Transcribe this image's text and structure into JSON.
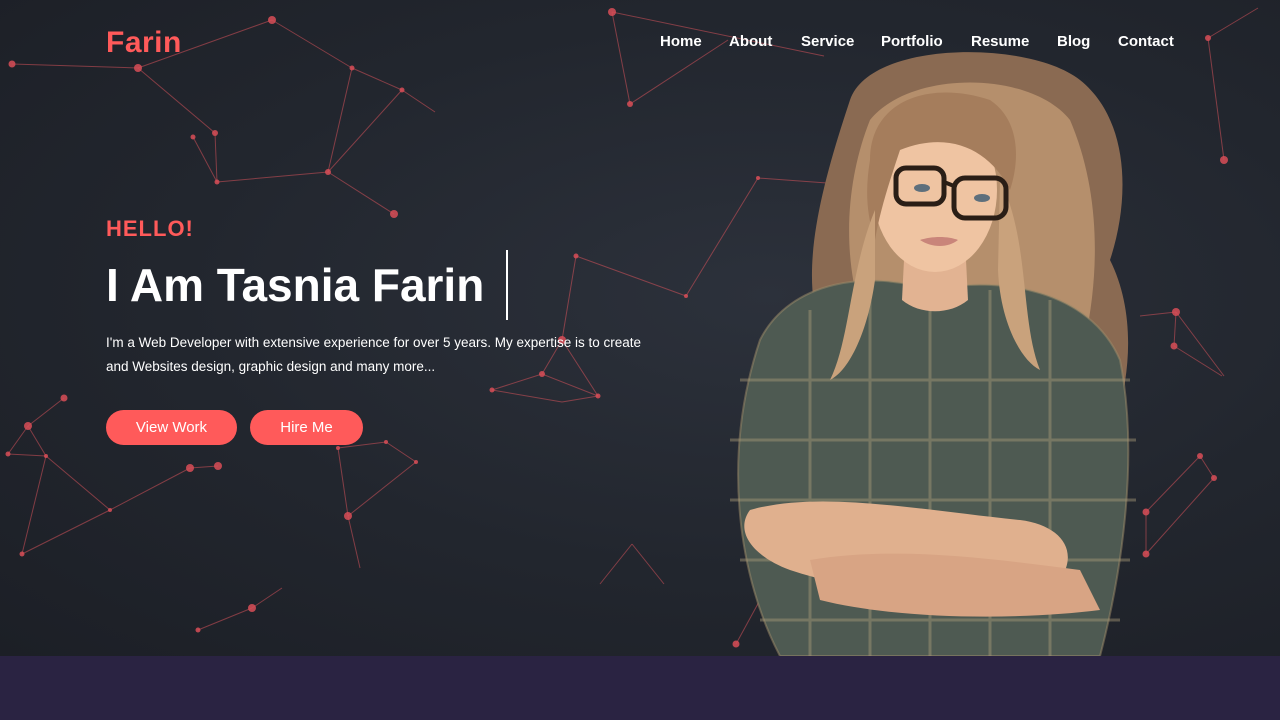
{
  "header": {
    "logo": "Farin",
    "nav": [
      "Home",
      "About",
      "Service",
      "Portfolio",
      "Resume",
      "Blog",
      "Contact"
    ]
  },
  "hero": {
    "greeting": "HELLO!",
    "headline": "I Am Tasnia Farin",
    "intro_line1": "I'm a Web Developer with extensive experience for over 5 years. My expertise is to create",
    "intro_line2": "and Websites design, graphic design and many more...",
    "buttons": {
      "view_work": "View Work",
      "hire_me": "Hire Me"
    }
  },
  "colors": {
    "accent": "#ff5a5a",
    "hero_bg": "#22262e",
    "footer_band": "#2a2342",
    "text": "#ffffff"
  },
  "icons": [
    "particle-network-background",
    "portrait-photo"
  ]
}
